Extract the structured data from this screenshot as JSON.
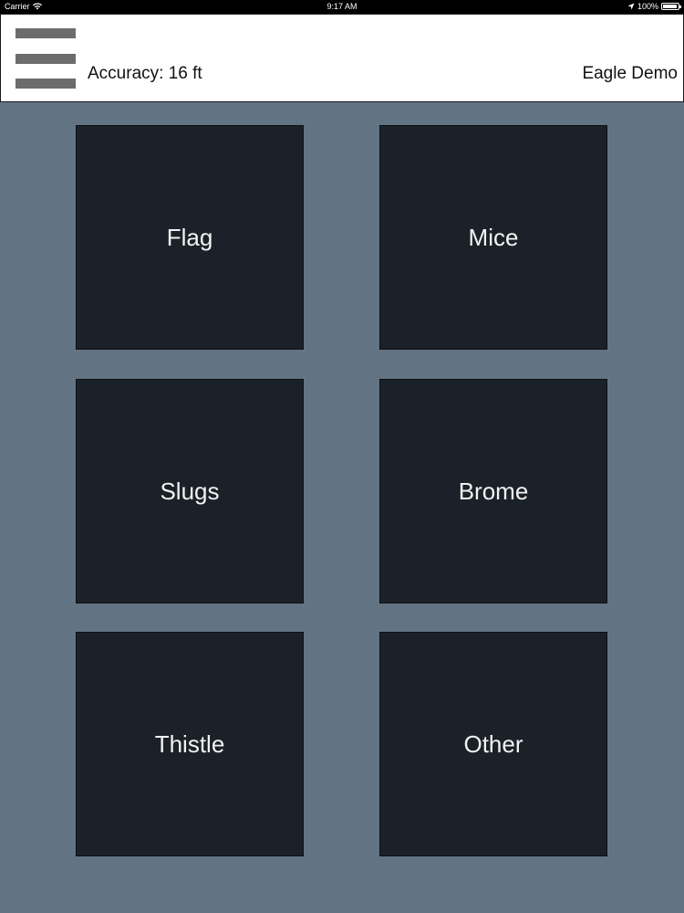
{
  "status_bar": {
    "carrier": "Carrier",
    "time": "9:17 AM",
    "battery": "100%"
  },
  "header": {
    "accuracy": "Accuracy: 16 ft",
    "app_name": "Eagle Demo"
  },
  "tiles": [
    {
      "label": "Flag"
    },
    {
      "label": "Mice"
    },
    {
      "label": "Slugs"
    },
    {
      "label": "Brome"
    },
    {
      "label": "Thistle"
    },
    {
      "label": "Other"
    }
  ],
  "colors": {
    "background": "#627384",
    "tile": "#1b2128",
    "tile_text": "#f2f2f2",
    "header": "#ffffff",
    "menu_icon": "#6c6c6c"
  }
}
